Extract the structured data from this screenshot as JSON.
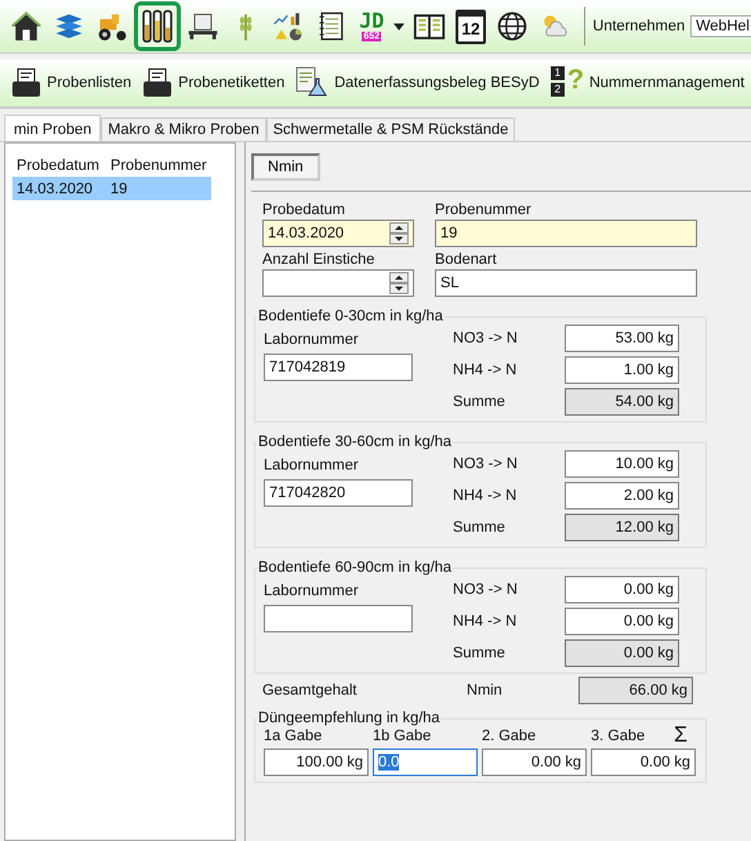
{
  "toolbar": {
    "icons": [
      {
        "kind": "house",
        "selected": false
      },
      {
        "kind": "layers",
        "selected": false
      },
      {
        "kind": "tractor",
        "selected": false
      },
      {
        "kind": "tubes",
        "selected": true
      },
      {
        "kind": "pallet",
        "selected": false
      },
      {
        "kind": "wheat",
        "selected": false
      },
      {
        "kind": "charts",
        "selected": false
      },
      {
        "kind": "notebook",
        "selected": false
      },
      {
        "kind": "logo",
        "selected": false,
        "text": "JD",
        "subtext": "652"
      },
      {
        "kind": "caret",
        "selected": false
      },
      {
        "kind": "book",
        "selected": false
      },
      {
        "kind": "calendar",
        "selected": false,
        "text": "12"
      },
      {
        "kind": "globe",
        "selected": false
      },
      {
        "kind": "weather",
        "selected": false
      }
    ],
    "company_label": "Unternehmen",
    "company_value": "WebHel"
  },
  "actions": [
    {
      "kind": "printer",
      "label": "Probenlisten"
    },
    {
      "kind": "printer",
      "label": "Probenetiketten"
    },
    {
      "kind": "flask",
      "label": "Datenerfassungsbeleg BESyD"
    },
    {
      "kind": "numbers",
      "label": "Nummernmanagement",
      "digits": [
        "1",
        "2"
      ],
      "sign": "?"
    }
  ],
  "tabs": [
    {
      "label": "min Proben",
      "selected": true
    },
    {
      "label": "Makro & Mikro Proben",
      "selected": false
    },
    {
      "label": "Schwermetalle & PSM Rückstände",
      "selected": false
    }
  ],
  "list": {
    "columns": [
      "Probedatum",
      "Probenummer"
    ],
    "rows": [
      {
        "cells": [
          "14.03.2020",
          "19"
        ],
        "selected": true
      }
    ]
  },
  "subtabs": [
    {
      "label": "Nmin",
      "selected": true
    }
  ],
  "header_fields": [
    {
      "label": "Probedatum",
      "value": "14.03.2020",
      "kind": "spinner",
      "required": true
    },
    {
      "label": "Probenummer",
      "value": "19",
      "kind": "text",
      "required": true
    },
    {
      "label": "Anzahl Einstiche",
      "kind": "spinner",
      "required": false
    },
    {
      "label": "Bodenart",
      "value": "SL",
      "kind": "text",
      "required": false
    }
  ],
  "depth_groups": [
    {
      "title": "Bodentiefe 0-30cm in kg/ha",
      "lab_label": "Labornummer",
      "lab_value": "717042819",
      "rows": [
        {
          "label": "NO3 -> N",
          "value": "53.00 kg",
          "readonly": false
        },
        {
          "label": "NH4 -> N",
          "value": "1.00 kg",
          "readonly": false
        },
        {
          "label": "Summe",
          "value": "54.00 kg",
          "readonly": true
        }
      ]
    },
    {
      "title": "Bodentiefe 30-60cm in kg/ha",
      "lab_label": "Labornummer",
      "lab_value": "717042820",
      "rows": [
        {
          "label": "NO3 -> N",
          "value": "10.00 kg",
          "readonly": false
        },
        {
          "label": "NH4 -> N",
          "value": "2.00 kg",
          "readonly": false
        },
        {
          "label": "Summe",
          "value": "12.00 kg",
          "readonly": true
        }
      ]
    },
    {
      "title": "Bodentiefe 60-90cm in kg/ha",
      "lab_label": "Labornummer",
      "rows": [
        {
          "label": "NO3 -> N",
          "value": "0.00 kg",
          "readonly": false
        },
        {
          "label": "NH4 -> N",
          "value": "0.00 kg",
          "readonly": false
        },
        {
          "label": "Summe",
          "value": "0.00 kg",
          "readonly": true
        }
      ]
    }
  ],
  "total": {
    "label": "Gesamtgehalt",
    "sublabel": "Nmin",
    "value": "66.00 kg"
  },
  "fertilizer": {
    "title": "Düngeempfehlung in kg/ha",
    "sum_sign": "Σ",
    "doses": [
      {
        "label": "1a Gabe",
        "value": "100.00 kg",
        "focused": false
      },
      {
        "label": "1b Gabe",
        "value": "0.0",
        "focused": true
      },
      {
        "label": "2. Gabe",
        "value": "0.00 kg",
        "focused": false
      },
      {
        "label": "3. Gabe",
        "value": "0.00 kg",
        "focused": false
      }
    ]
  }
}
